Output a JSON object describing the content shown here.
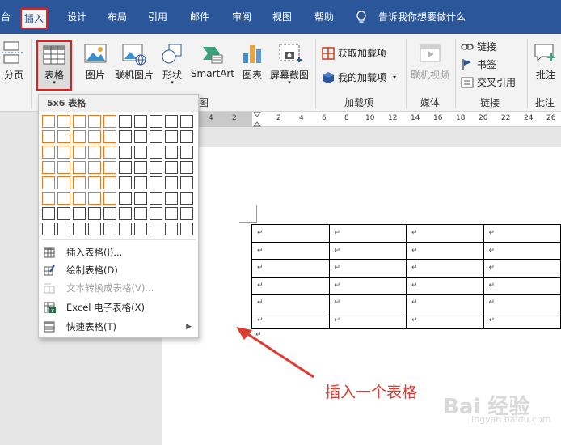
{
  "tabs": {
    "partial_left": "台",
    "insert": "插入",
    "design": "设计",
    "layout": "布局",
    "references": "引用",
    "mailings": "邮件",
    "review": "审阅",
    "view": "视图",
    "help": "帮助",
    "tell_me": "告诉我你想要做什么"
  },
  "ribbon": {
    "page_break": "分页",
    "table": "表格",
    "pictures": "图片",
    "online_pictures": "联机图片",
    "shapes": "形状",
    "smartart": "SmartArt",
    "chart": "图表",
    "screenshot": "屏幕截图",
    "get_addins": "获取加载项",
    "my_addins": "我的加载项",
    "online_video": "联机视频",
    "link": "链接",
    "bookmark": "书签",
    "cross_reference": "交叉引用",
    "comment": "批注",
    "groups": {
      "illustrations_partial": "图",
      "addins": "加载项",
      "media": "媒体",
      "links": "链接",
      "comments": "批注"
    }
  },
  "ruler": {
    "numbers_left": [
      "4",
      "2"
    ],
    "numbers_right": [
      "2",
      "4",
      "6",
      "8",
      "10",
      "12",
      "14",
      "16",
      "18",
      "20",
      "22",
      "24",
      "26"
    ]
  },
  "table_dropdown": {
    "title": "5x6 表格",
    "grid_cols": 10,
    "grid_rows": 8,
    "selected_cols": 5,
    "selected_rows": 6,
    "items": [
      {
        "label": "插入表格(I)...",
        "icon": "insert-table-icon",
        "enabled": true
      },
      {
        "label": "绘制表格(D)",
        "icon": "draw-table-icon",
        "enabled": true
      },
      {
        "label": "文本转换成表格(V)...",
        "icon": "text-to-table-icon",
        "enabled": false
      },
      {
        "label": "Excel 电子表格(X)",
        "icon": "excel-icon",
        "enabled": true
      },
      {
        "label": "快速表格(T)",
        "icon": "quick-tables-icon",
        "enabled": true
      }
    ]
  },
  "document": {
    "cell_mark": "↵",
    "rows": 6,
    "cols": 4
  },
  "annotation": "插入一个表格",
  "watermark": {
    "main": "Bai 经验",
    "sub": "jingyan.baidu.com"
  },
  "colors": {
    "ribbon_blue": "#2b579a",
    "highlight_red": "#e0201c",
    "grid_orange": "#e87722",
    "annotation_red": "#e03a2f"
  }
}
